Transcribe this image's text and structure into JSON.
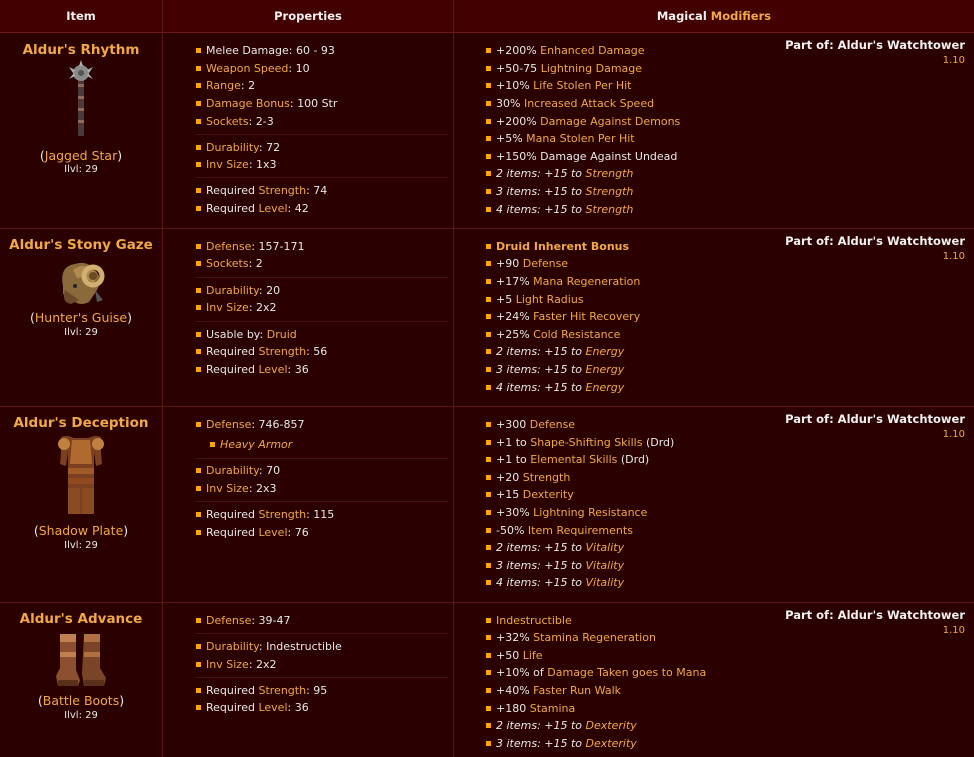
{
  "header": {
    "col_item": "Item",
    "col_properties": "Properties",
    "col_mods_a": "Magical ",
    "col_mods_b": "Modifiers"
  },
  "colors": {
    "gold": "#f0a848",
    "bullet": "#ffa500",
    "background": "#2a0000",
    "header": "#420000"
  },
  "items": [
    {
      "name": "Aldur's Rhythm",
      "base": "Jagged Star",
      "ilvl": "Ilvl: 29",
      "icon": "jagged-star-icon",
      "part_of": "Part of: Aldur's Watchtower",
      "version": "1.10",
      "props": [
        [
          {
            "l": "Melee Damage: 60 - 93",
            "v": ""
          },
          {
            "l": "Weapon Speed",
            "v": ": 10"
          },
          {
            "l": "Range",
            "v": ": 2"
          },
          {
            "l": "Damage Bonus",
            "v": ": 100 Str"
          },
          {
            "l": "Sockets",
            "v": ": 2-3"
          }
        ],
        [
          {
            "l": "Durability",
            "v": ": 72"
          },
          {
            "l": "Inv Size",
            "v": ": 1x3"
          }
        ],
        [
          {
            "l": "Required ",
            "g": "Strength",
            "v": ": 74"
          },
          {
            "l": "Required ",
            "g": "Level",
            "v": ": 42"
          }
        ]
      ],
      "mods": [
        {
          "w": "+200% ",
          "g": "Enhanced Damage"
        },
        {
          "w": "+50-75 ",
          "g": "Lightning Damage"
        },
        {
          "w": "+10% ",
          "g": "Life Stolen Per Hit"
        },
        {
          "w": "30% ",
          "g": "Increased Attack Speed"
        },
        {
          "w": "+200% ",
          "g": "Damage Against Demons"
        },
        {
          "w": "+5% ",
          "g": "Mana Stolen Per Hit"
        },
        {
          "w": "+150% Damage Against Undead",
          "g": ""
        },
        {
          "w": "2 items: +15 to ",
          "g": "Strength",
          "i": true
        },
        {
          "w": "3 items: +15 to ",
          "g": "Strength",
          "i": true
        },
        {
          "w": "4 items: +15 to ",
          "g": "Strength",
          "i": true
        }
      ]
    },
    {
      "name": "Aldur's Stony Gaze",
      "base": "Hunter's Guise",
      "ilvl": "Ilvl: 29",
      "icon": "hunters-guise-icon",
      "part_of": "Part of: Aldur's Watchtower",
      "version": "1.10",
      "props": [
        [
          {
            "l": "Defense",
            "v": ": 157-171"
          },
          {
            "l": "Sockets",
            "v": ": 2"
          }
        ],
        [
          {
            "l": "Durability",
            "v": ": 20"
          },
          {
            "l": "Inv Size",
            "v": ": 2x2"
          }
        ],
        [
          {
            "l": "Usable by: ",
            "g": "Druid",
            "v": ""
          },
          {
            "l": "Required ",
            "g": "Strength",
            "v": ": 56"
          },
          {
            "l": "Required ",
            "g": "Level",
            "v": ": 36"
          }
        ]
      ],
      "mods": [
        {
          "w": "",
          "g": "Druid Inherent Bonus",
          "bold": true
        },
        {
          "w": "+90 ",
          "g": "Defense"
        },
        {
          "w": "+17% ",
          "g": "Mana Regeneration"
        },
        {
          "w": "+5 ",
          "g": "Light Radius"
        },
        {
          "w": "+24% ",
          "g": "Faster Hit Recovery"
        },
        {
          "w": "+25% ",
          "g": "Cold Resistance"
        },
        {
          "w": "2 items: +15 to ",
          "g": "Energy",
          "i": true
        },
        {
          "w": "3 items: +15 to ",
          "g": "Energy",
          "i": true
        },
        {
          "w": "4 items: +15 to ",
          "g": "Energy",
          "i": true
        }
      ]
    },
    {
      "name": "Aldur's Deception",
      "base": "Shadow Plate",
      "ilvl": "Ilvl: 29",
      "icon": "shadow-plate-icon",
      "part_of": "Part of: Aldur's Watchtower",
      "version": "1.10",
      "armor_type": "Heavy Armor",
      "props": [
        [
          {
            "l": "Defense",
            "v": ": 746-857"
          }
        ],
        [
          {
            "l": "Durability",
            "v": ": 70"
          },
          {
            "l": "Inv Size",
            "v": ": 2x3"
          }
        ],
        [
          {
            "l": "Required ",
            "g": "Strength",
            "v": ": 115"
          },
          {
            "l": "Required ",
            "g": "Level",
            "v": ": 76"
          }
        ]
      ],
      "mods": [
        {
          "w": "+300 ",
          "g": "Defense"
        },
        {
          "w": "+1 to ",
          "g": "Shape-Shifting Skills",
          "t": " (Drd)"
        },
        {
          "w": "+1 to ",
          "g": "Elemental Skills",
          "t": " (Drd)"
        },
        {
          "w": "+20 ",
          "g": "Strength"
        },
        {
          "w": "+15 ",
          "g": "Dexterity"
        },
        {
          "w": "+30% ",
          "g": "Lightning Resistance"
        },
        {
          "w": "-50% ",
          "g": "Item Requirements"
        },
        {
          "w": "2 items: +15 to ",
          "g": "Vitality",
          "i": true
        },
        {
          "w": "3 items: +15 to ",
          "g": "Vitality",
          "i": true
        },
        {
          "w": "4 items: +15 to ",
          "g": "Vitality",
          "i": true
        }
      ]
    },
    {
      "name": "Aldur's Advance",
      "base": "Battle Boots",
      "ilvl": "Ilvl: 29",
      "icon": "battle-boots-icon",
      "part_of": "Part of: Aldur's Watchtower",
      "version": "1.10",
      "props": [
        [
          {
            "l": "Defense",
            "v": ": 39-47"
          }
        ],
        [
          {
            "l": "Durability",
            "v": ": Indestructible"
          },
          {
            "l": "Inv Size",
            "v": ": 2x2"
          }
        ],
        [
          {
            "l": "Required ",
            "g": "Strength",
            "v": ": 95"
          },
          {
            "l": "Required ",
            "g": "Level",
            "v": ": 36"
          }
        ]
      ],
      "mods": [
        {
          "w": "",
          "g": "Indestructible"
        },
        {
          "w": "+32% ",
          "g": "Stamina Regeneration"
        },
        {
          "w": "+50 ",
          "g": "Life"
        },
        {
          "w": "+10% of ",
          "g": "Damage Taken goes to Mana"
        },
        {
          "w": "+40% ",
          "g": "Faster Run Walk"
        },
        {
          "w": "+180 ",
          "g": "Stamina"
        },
        {
          "w": "2 items: +15 to ",
          "g": "Dexterity",
          "i": true
        },
        {
          "w": "3 items: +15 to ",
          "g": "Dexterity",
          "i": true
        }
      ]
    }
  ]
}
